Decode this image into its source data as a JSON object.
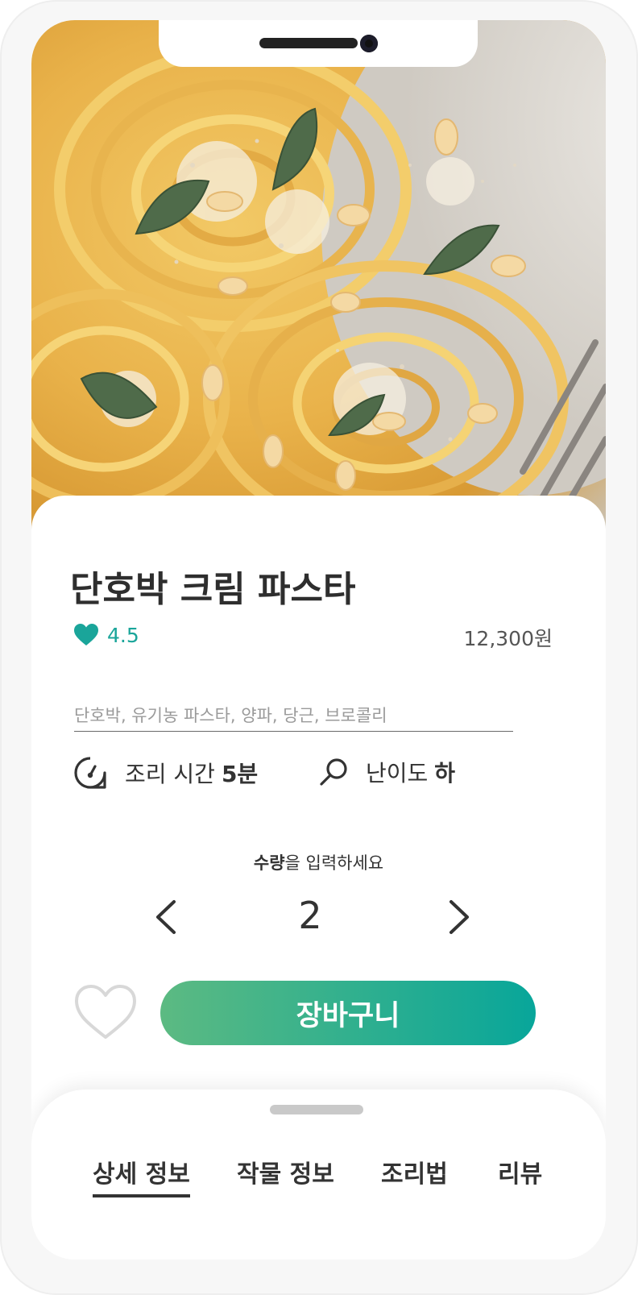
{
  "recipe": {
    "title": "단호박 크림 파스타",
    "rating": "4.5",
    "price": "12,300원",
    "ingredients": "단호박, 유기농 파스타, 양파, 당근, 브로콜리"
  },
  "meta": {
    "cook_time_label": "조리 시간",
    "cook_time_value": "5분",
    "difficulty_label": "난이도",
    "difficulty_value": "하"
  },
  "quantity": {
    "prompt_bold": "수량",
    "prompt_rest": "을 입력하세요",
    "value": "2"
  },
  "cart_button_label": "장바구니",
  "tabs": [
    {
      "label": "상세 정보",
      "active": true
    },
    {
      "label": "작물 정보",
      "active": false
    },
    {
      "label": "조리법",
      "active": false
    },
    {
      "label": "리뷰",
      "active": false
    }
  ],
  "icons": {
    "rating": "heart-filled-icon",
    "cook_time": "timer-gauge-icon",
    "difficulty": "search-icon",
    "qty_decrease": "chevron-left-icon",
    "qty_increase": "chevron-right-icon",
    "wishlist": "heart-outline-icon"
  },
  "colors": {
    "accent": "#1aa59a",
    "button_gradient_start": "#5cba82",
    "button_gradient_end": "#08a69a"
  }
}
